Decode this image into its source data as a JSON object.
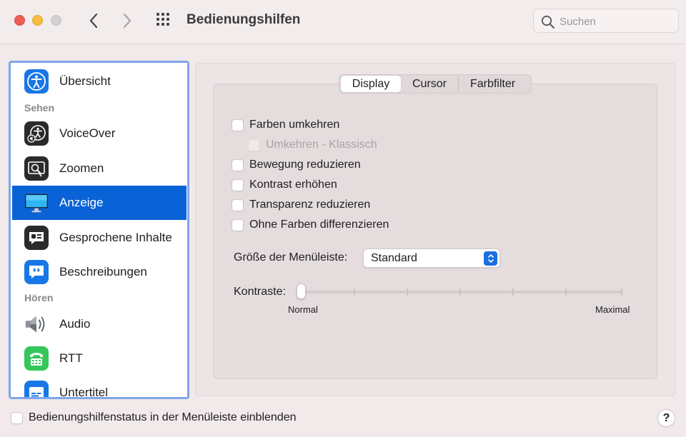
{
  "window": {
    "title": "Bedienungshilfen"
  },
  "search": {
    "placeholder": "Suchen",
    "value": ""
  },
  "sidebar": {
    "items": [
      {
        "label": "Übersicht",
        "icon": "accessibility-icon"
      },
      {
        "label": "VoiceOver",
        "icon": "voiceover-icon"
      },
      {
        "label": "Zoomen",
        "icon": "zoom-icon"
      },
      {
        "label": "Anzeige",
        "icon": "display-icon",
        "selected": true
      },
      {
        "label": "Gesprochene Inhalte",
        "icon": "spoken-content-icon"
      },
      {
        "label": "Beschreibungen",
        "icon": "descriptions-icon"
      },
      {
        "label": "Audio",
        "icon": "speaker-icon"
      },
      {
        "label": "RTT",
        "icon": "rtt-icon"
      },
      {
        "label": "Untertitel",
        "icon": "captions-icon"
      }
    ],
    "sections": {
      "vision": "Sehen",
      "hearing": "Hören"
    }
  },
  "tabs": [
    {
      "label": "Display",
      "active": true
    },
    {
      "label": "Cursor",
      "active": false
    },
    {
      "label": "Farbfilter",
      "active": false
    }
  ],
  "options": {
    "invert_colors": "Farben umkehren",
    "invert_classic": "Umkehren - Klassisch",
    "reduce_motion": "Bewegung reduzieren",
    "increase_contrast": "Kontrast erhöhen",
    "reduce_transparency": "Transparenz reduzieren",
    "differentiate_without_color": "Ohne Farben differenzieren"
  },
  "menubar_size": {
    "label": "Größe der Menüleiste:",
    "value": "Standard"
  },
  "contrast": {
    "label": "Kontraste:",
    "min_label": "Normal",
    "max_label": "Maximal",
    "level": 0
  },
  "footer": {
    "status_checkbox": "Bedienungshilfenstatus in der Menüleiste einblenden",
    "help": "?"
  },
  "colors": {
    "accent": "#0a63d6",
    "close": "#ee5c55",
    "minimize": "#f6be3b",
    "zoom_disabled": "#d4cfd0"
  }
}
